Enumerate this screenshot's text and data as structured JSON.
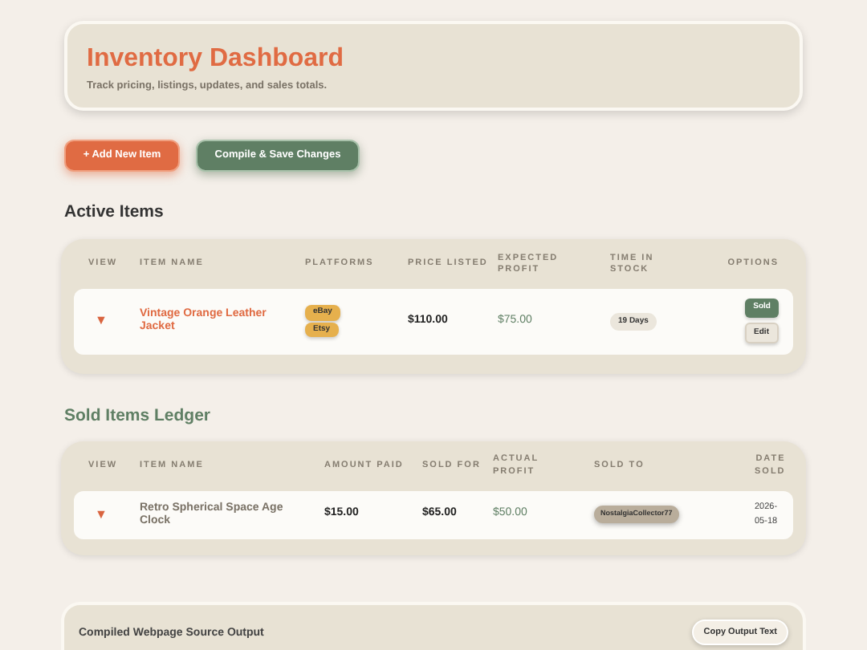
{
  "header": {
    "title": "Inventory Dashboard",
    "subtitle": "Track pricing, listings, updates, and sales totals."
  },
  "actions": [
    {
      "label": "+ Add New Item",
      "kind": "primary"
    },
    {
      "label": "Compile & Save Changes",
      "kind": "secondary"
    }
  ],
  "active_items": {
    "heading": "Active Items",
    "columns": [
      "VIEW",
      "ITEM NAME",
      "PLATFORMS",
      "PRICE LISTED",
      "EXPECTED PROFIT",
      "TIME IN STOCK",
      "OPTIONS"
    ],
    "rows": [
      {
        "toggle": "▼",
        "name": "Vintage Orange Leather Jacket",
        "platforms": [
          "eBay",
          "Etsy"
        ],
        "price": "$110.00",
        "profit": "$75.00",
        "time": "19 Days",
        "options": [
          {
            "label": "Sold",
            "kind": "sold"
          },
          {
            "label": "Edit",
            "kind": "edit"
          }
        ]
      }
    ]
  },
  "sold_items": {
    "heading": "Sold Items Ledger",
    "columns": [
      "VIEW",
      "ITEM NAME",
      "AMOUNT PAID",
      "SOLD FOR",
      "ACTUAL PROFIT",
      "SOLD TO",
      "DATE SOLD"
    ],
    "rows": [
      {
        "toggle": "▼",
        "name": "Retro Spherical Space Age Clock",
        "paid": "$15.00",
        "sold_for": "$65.00",
        "profit": "$50.00",
        "buyer": "NostalgiaCollector77",
        "date": "2026-05-18"
      }
    ]
  },
  "output": {
    "title": "Compiled Webpage Source Output",
    "copy_button": "Copy Output Text"
  }
}
